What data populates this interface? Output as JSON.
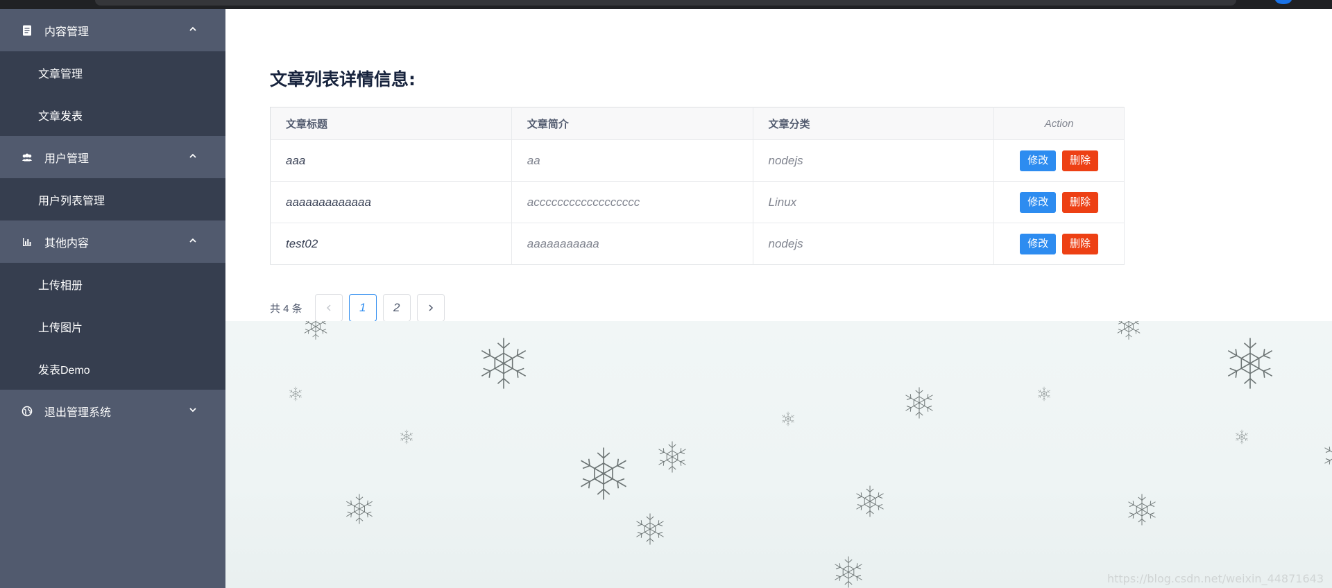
{
  "sidebar": {
    "menus": [
      {
        "title": "内容管理",
        "icon": "document-icon",
        "expanded": true,
        "items": [
          {
            "label": "文章管理"
          },
          {
            "label": "文章发表"
          }
        ]
      },
      {
        "title": "用户管理",
        "icon": "people-icon",
        "expanded": true,
        "items": [
          {
            "label": "用户列表管理"
          }
        ]
      },
      {
        "title": "其他内容",
        "icon": "stats-icon",
        "expanded": true,
        "items": [
          {
            "label": "上传相册"
          },
          {
            "label": "上传图片"
          },
          {
            "label": "发表Demo"
          }
        ]
      },
      {
        "title": "退出管理系统",
        "icon": "globe-icon",
        "expanded": false,
        "items": []
      }
    ]
  },
  "main": {
    "title": "文章列表详情信息:",
    "table": {
      "columns": [
        "文章标题",
        "文章简介",
        "文章分类",
        "Action"
      ],
      "rows": [
        {
          "title": "aaa",
          "summary": "aa",
          "category": "nodejs"
        },
        {
          "title": "aaaaaaaaaaaaa",
          "summary": "acccccccccccccccccc",
          "category": "Linux"
        },
        {
          "title": "test02",
          "summary": "aaaaaaaaaaa",
          "category": "nodejs"
        }
      ],
      "edit_label": "修改",
      "delete_label": "删除"
    },
    "pagination": {
      "total_text": "共 4 条",
      "pages": [
        "1",
        "2"
      ],
      "current": "1"
    }
  },
  "watermark": "https://blog.csdn.net/weixin_44871643",
  "colors": {
    "sidebar": "#515a6e",
    "submenu": "#363e4f",
    "primary": "#2d8cf0",
    "error": "#ed4014"
  }
}
